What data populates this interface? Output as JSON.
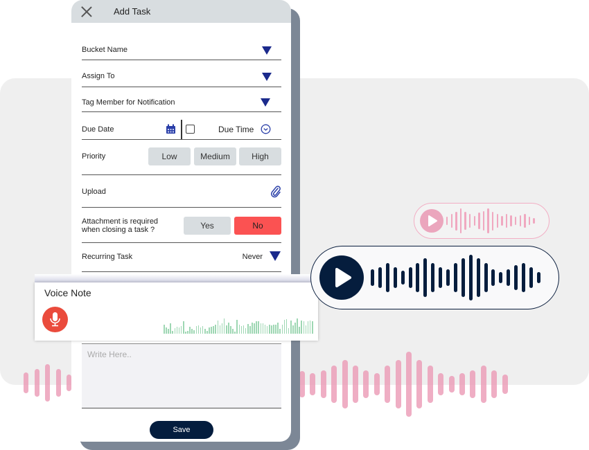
{
  "dialog": {
    "title": "Add Task",
    "close_icon": "close-icon",
    "fields": {
      "bucket_name": "Bucket Name",
      "assign_to": "Assign To",
      "tag_member": "Tag Member for Notification",
      "due_date": "Due Date",
      "due_time": "Due Time",
      "priority": "Priority",
      "upload": "Upload",
      "attachment_required_line1": "Attachment is required",
      "attachment_required_line2": "when closing a task ?",
      "recurring_task": "Recurring Task",
      "recurring_value": "Never",
      "voice_note_under": "Voice Note"
    },
    "priority_options": [
      "Low",
      "Medium",
      "High"
    ],
    "attachment_options": {
      "yes": "Yes",
      "no": "No",
      "selected": "No"
    },
    "textarea_placeholder": "Write Here..",
    "save_label": "Save"
  },
  "voice_note": {
    "title": "Voice Note",
    "mic_icon": "microphone-icon"
  },
  "colors": {
    "accent_dark": "#041d3e",
    "dropdown_arrow": "#1b2a8c",
    "no_selected": "#fb5252",
    "pink_wave": "#eb9ab5",
    "mic_red": "#ea4b3c",
    "waveform_green": "#9ed7b3"
  },
  "waveforms": {
    "big_player_bars": [
      0.35,
      0.45,
      0.65,
      0.45,
      0.3,
      0.45,
      0.65,
      0.85,
      0.65,
      0.45,
      0.35,
      0.65,
      0.85,
      1.0,
      0.85,
      0.65,
      0.35,
      0.25,
      0.35,
      0.55,
      0.65,
      0.45,
      0.25
    ],
    "small_player_bars": [
      0.35,
      0.55,
      0.75,
      1.0,
      0.7,
      0.55,
      0.4,
      0.65,
      0.8,
      1.0,
      0.75,
      0.55,
      0.4,
      0.55,
      0.45,
      0.35,
      0.45,
      0.55,
      0.35,
      0.2
    ],
    "pink_bg_right": [
      0.4,
      0.33,
      0.42,
      0.58,
      0.75,
      0.58,
      0.42,
      0.33,
      0.58,
      0.75,
      1.0,
      0.75,
      0.58,
      0.33,
      0.25,
      0.33,
      0.42,
      0.58,
      0.42,
      0.29
    ],
    "pink_bg_left": [
      0.55,
      0.75,
      1.0,
      0.75,
      0.45
    ],
    "recorded_bars": [
      0.6,
      0.4,
      0.3,
      0.7,
      0.2,
      0.35,
      0.45,
      0.4,
      0.5,
      0.8,
      0.15,
      0.2,
      0.45,
      0.3,
      0.25,
      0.5,
      0.55,
      0.4,
      0.5,
      0.3,
      0.2,
      0.4,
      0.45,
      0.5,
      0.6,
      0.85,
      0.55,
      0.7,
      1.0,
      0.55,
      0.75,
      0.5,
      0.3,
      0.15,
      0.9,
      0.6,
      0.5,
      0.55,
      0.35,
      0.65,
      0.5,
      0.75,
      0.7,
      0.8,
      0.8,
      0.7,
      0.7,
      0.6,
      0.5,
      0.6,
      0.55,
      0.6,
      0.6,
      0.75,
      0.3,
      0.6,
      0.9,
      0.95,
      0.35,
      0.85,
      0.55,
      0.75,
      1.0,
      0.45,
      0.85,
      0.8,
      0.55,
      0.8,
      0.85,
      0.8
    ]
  }
}
